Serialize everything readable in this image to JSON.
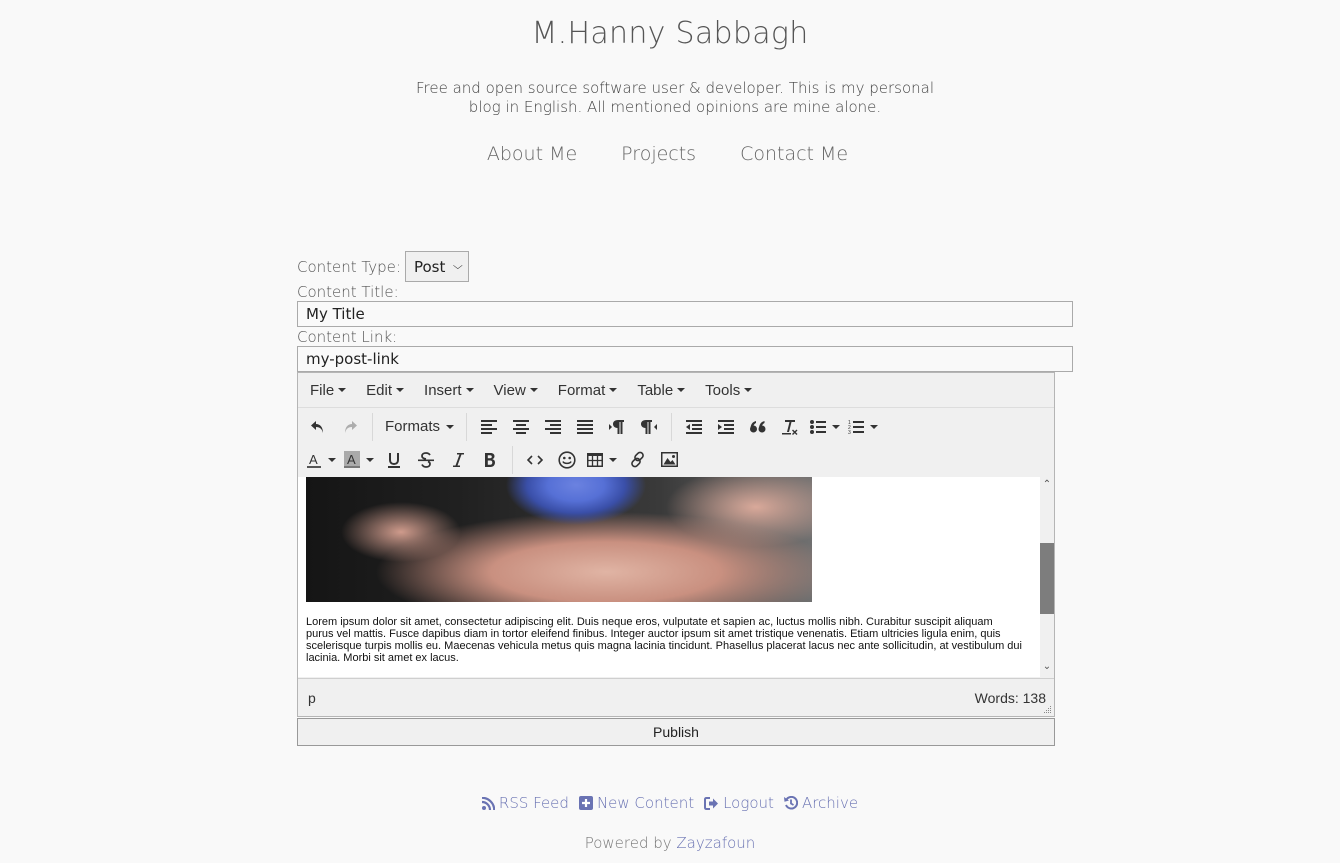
{
  "header": {
    "title": "M.Hanny Sabbagh",
    "description": "Free and open source software user & developer. This is my personal blog in English. All mentioned opinions are mine alone."
  },
  "nav": {
    "items": [
      {
        "label": "About Me"
      },
      {
        "label": "Projects"
      },
      {
        "label": "Contact Me"
      }
    ]
  },
  "form": {
    "content_type_label": "Content Type:",
    "content_type_value": "Post",
    "content_title_label": "Content Title:",
    "content_title_value": "My Title",
    "content_link_label": "Content Link:",
    "content_link_value": "my-post-link"
  },
  "editor": {
    "menu": [
      "File",
      "Edit",
      "Insert",
      "View",
      "Format",
      "Table",
      "Tools"
    ],
    "toolbar": {
      "formats_label": "Formats",
      "icons_row1": [
        "undo-icon",
        "redo-icon",
        "formats-dropdown",
        "align-left-icon",
        "align-center-icon",
        "align-right-icon",
        "align-justify-icon",
        "ltr-icon",
        "rtl-icon",
        "outdent-icon",
        "indent-icon",
        "blockquote-icon",
        "clear-formatting-icon",
        "bullet-list-icon",
        "numbered-list-icon"
      ],
      "icons_row2": [
        "text-color-icon",
        "background-color-icon",
        "underline-icon",
        "strikethrough-icon",
        "italic-icon",
        "bold-icon",
        "code-icon",
        "emoticons-icon",
        "table-icon",
        "link-icon",
        "image-icon"
      ]
    },
    "content": {
      "paragraph1": "Lorem ipsum dolor sit amet, consectetur adipiscing elit. Duis neque eros, vulputate et sapien ac, luctus mollis nibh. Curabitur suscipit aliquam purus vel mattis. Fusce dapibus diam in tortor eleifend finibus. Integer auctor ipsum sit amet tristique venenatis. Etiam ultricies ligula enim, quis scelerisque turpis mollis eu. Maecenas vehicula metus quis magna lacinia tincidunt. Phasellus placerat lacus nec ante sollicitudin, at vestibulum dui lacinia. Morbi sit amet ex lacus."
    },
    "scroll": {
      "position_fraction": 0.45,
      "visible_fraction": 0.43
    },
    "status": {
      "path": "p",
      "word_count": "Words: 138"
    }
  },
  "publish_label": "Publish",
  "footer": {
    "links": [
      {
        "label": "RSS Feed",
        "icon": "rss-icon"
      },
      {
        "label": "New Content",
        "icon": "plus-square-icon"
      },
      {
        "label": "Logout",
        "icon": "sign-out-icon"
      },
      {
        "label": "Archive",
        "icon": "history-icon"
      }
    ],
    "powered_prefix": "Powered by ",
    "powered_link": "Zayzafoun"
  },
  "colors": {
    "link": "#6a73b3",
    "background": "#f9f9f9",
    "scroll_thumb": "#7d7d7d"
  }
}
